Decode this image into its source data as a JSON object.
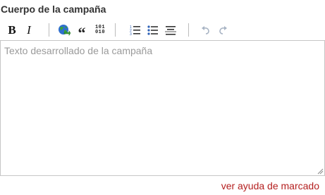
{
  "field": {
    "label": "Cuerpo de la campaña"
  },
  "toolbar": {
    "bold_label": "B",
    "italic_label": "I",
    "link_icon": "globe-link-icon",
    "quote_label": "“",
    "code_label_top": "101",
    "code_label_bottom": "010",
    "ordered_list_icon": "ordered-list-icon",
    "unordered_list_icon": "unordered-list-icon",
    "heading_icon": "heading-icon",
    "undo_icon": "undo-icon",
    "redo_icon": "redo-icon"
  },
  "editor": {
    "value": "",
    "placeholder": "Texto desarrollado de la campaña"
  },
  "help": {
    "link_text": "ver ayuda de marcado"
  },
  "colors": {
    "label_text": "#333333",
    "placeholder": "#9a9a9a",
    "border": "#c6c6c6",
    "help_link": "#b41e1e",
    "globe_blue": "#2f6fcf",
    "globe_green": "#3aa33a",
    "list_blue": "#2b5fb5",
    "undo_gray": "#a8b4c4"
  }
}
